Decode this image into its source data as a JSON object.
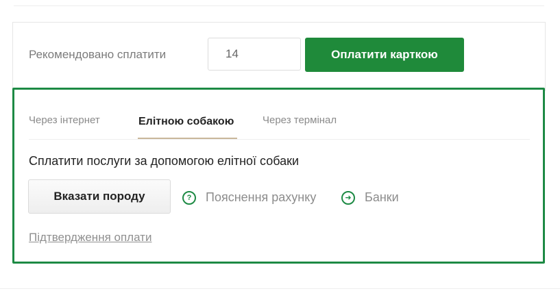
{
  "payment": {
    "recommended_label": "Рекомендовано сплатити",
    "amount_value": "14",
    "pay_button_label": "Оплатити карткою"
  },
  "tabs": [
    {
      "label": "Через інтернет",
      "active": false
    },
    {
      "label": "Елітною собакою",
      "active": true
    },
    {
      "label": "Через термінал",
      "active": false
    }
  ],
  "panel": {
    "description": "Сплатити послуги за допомогою елітної собаки",
    "breed_button_label": "Вказати породу",
    "explain_link": {
      "icon": "question-circle-icon",
      "label": "Пояснення рахунку"
    },
    "banks_link": {
      "icon": "arrow-circle-icon",
      "label": "Банки"
    },
    "confirm_link": "Підтвердження оплати"
  },
  "colors": {
    "accent_green": "#1d8a44",
    "button_green": "#1f8a3a",
    "tab_underline": "#c9b79a"
  }
}
